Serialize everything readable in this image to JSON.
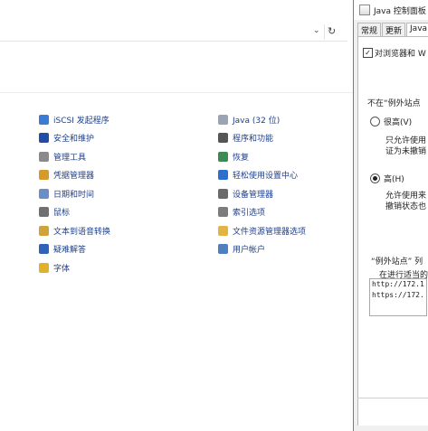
{
  "control_panel": {
    "address_bar": {
      "dropdown_glyph": "⌄",
      "refresh_glyph": "↻"
    },
    "column1": [
      {
        "label": "iSCSI 发起程序",
        "icon": "globe-icon",
        "color": "#3a7bd5"
      },
      {
        "label": "安全和维护",
        "icon": "flag-icon",
        "color": "#1f4ea8"
      },
      {
        "label": "管理工具",
        "icon": "admin-tools-icon",
        "color": "#8a8a8a"
      },
      {
        "label": "凭据管理器",
        "icon": "credential-icon",
        "color": "#d59a2a"
      },
      {
        "label": "日期和时间",
        "icon": "clock-icon",
        "color": "#6a8fc8"
      },
      {
        "label": "鼠标",
        "icon": "mouse-icon",
        "color": "#707070"
      },
      {
        "label": "文本到语音转换",
        "icon": "speech-icon",
        "color": "#d0a23a"
      },
      {
        "label": "疑难解答",
        "icon": "troubleshoot-icon",
        "color": "#2f63b8"
      },
      {
        "label": "字体",
        "icon": "font-icon",
        "color": "#e1b12c"
      }
    ],
    "column2": [
      {
        "label": "Java (32 位)",
        "icon": "java-icon",
        "color": "#9aa4b5"
      },
      {
        "label": "程序和功能",
        "icon": "programs-icon",
        "color": "#555555"
      },
      {
        "label": "恢复",
        "icon": "recovery-icon",
        "color": "#3d8a55"
      },
      {
        "label": "轻松使用设置中心",
        "icon": "ease-of-access-icon",
        "color": "#2d6fcf"
      },
      {
        "label": "设备管理器",
        "icon": "device-manager-icon",
        "color": "#6a6a6a"
      },
      {
        "label": "索引选项",
        "icon": "indexing-icon",
        "color": "#7c7c7c"
      },
      {
        "label": "文件资源管理器选项",
        "icon": "folder-options-icon",
        "color": "#e2b443"
      },
      {
        "label": "用户帐户",
        "icon": "user-accounts-icon",
        "color": "#4f7fbf"
      }
    ]
  },
  "java_panel": {
    "title": "Java 控制面板",
    "tabs": [
      "常规",
      "更新",
      "Java"
    ],
    "browser_checkbox_label": "对浏览器和 W",
    "exception_heading": "不在“例外站点",
    "radio_very_high": "很高(V)",
    "very_high_desc1": "只允许使用",
    "very_high_desc2": "证为未撤销",
    "radio_high": "高(H)",
    "high_desc1": "允许使用来",
    "high_desc2": "撤销状态也",
    "exception_list_heading": "“例外站点” 列",
    "exception_list_desc": "在进行适当的",
    "sites": [
      "http://172.1",
      "https://172."
    ]
  }
}
